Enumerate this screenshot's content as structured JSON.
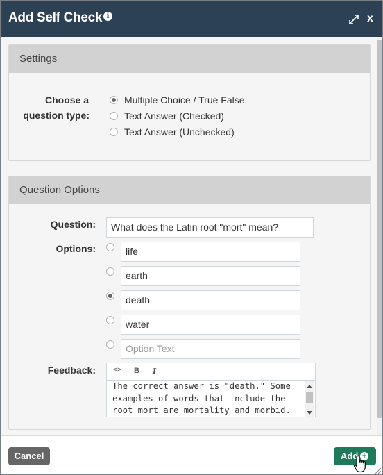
{
  "dialog": {
    "title": "Add Self Check",
    "info_icon": "info-icon",
    "expand_icon": "expand-icon",
    "close_label": "x"
  },
  "settings": {
    "header": "Settings",
    "type_label_line1": "Choose a",
    "type_label_line2": "question type:",
    "types": [
      {
        "label": "Multiple Choice / True False",
        "selected": true
      },
      {
        "label": "Text Answer (Checked)",
        "selected": false
      },
      {
        "label": "Text Answer (Unchecked)",
        "selected": false
      }
    ]
  },
  "question_options": {
    "header": "Question Options",
    "question_label": "Question:",
    "question_value": "What does the Latin root \"mort\" mean?",
    "options_label": "Options:",
    "options": [
      {
        "value": "life",
        "selected": false
      },
      {
        "value": "earth",
        "selected": false
      },
      {
        "value": "death",
        "selected": true
      },
      {
        "value": "water",
        "selected": false
      }
    ],
    "new_option_placeholder": "Option Text",
    "feedback_label": "Feedback:",
    "feedback_toolbar": {
      "code": "<>",
      "bold": "B",
      "italic": "I"
    },
    "feedback_text": "The correct answer is \"death.\" Some examples of words that include the root mort are mortality and morbid."
  },
  "footer": {
    "cancel_label": "Cancel",
    "add_label": "Add",
    "add_icon": "plus-circle-icon"
  },
  "colors": {
    "titlebar": "#2d4154",
    "add_button": "#1f7a5c",
    "cancel_button": "#666666",
    "panel_header": "#d2d2d2"
  }
}
